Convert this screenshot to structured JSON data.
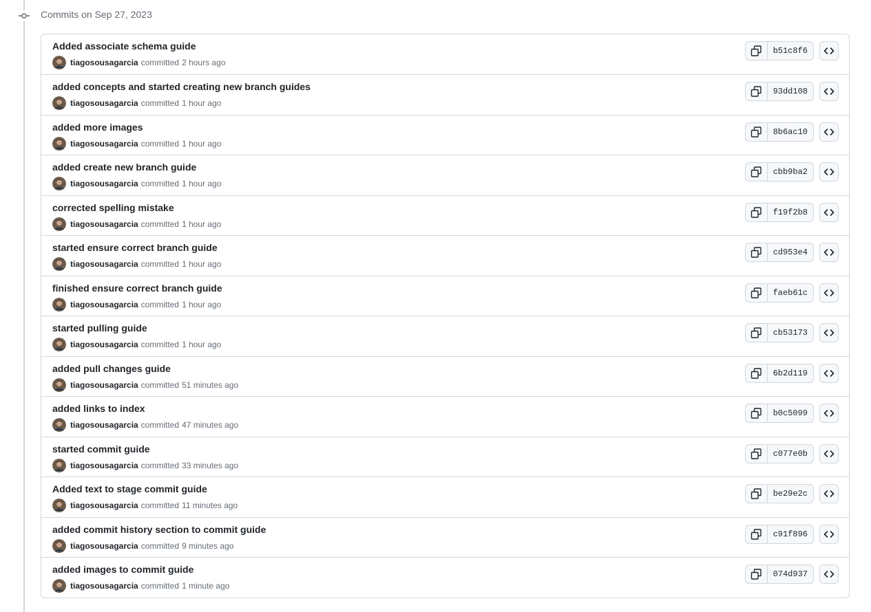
{
  "group": {
    "title": "Commits on Sep 27, 2023",
    "icon": "git-commit-icon"
  },
  "colors": {
    "border": "#d0d7de",
    "muted_text": "#656d76",
    "primary_text": "#1f2328",
    "button_bg": "#f6f8fa"
  },
  "commits": [
    {
      "message": "Added associate schema guide",
      "author": "tiagosousagarcia",
      "verb": "committed",
      "time": "2 hours ago",
      "sha": "b51c8f6"
    },
    {
      "message": "added concepts and started creating new branch guides",
      "author": "tiagosousagarcia",
      "verb": "committed",
      "time": "1 hour ago",
      "sha": "93dd108"
    },
    {
      "message": "added more images",
      "author": "tiagosousagarcia",
      "verb": "committed",
      "time": "1 hour ago",
      "sha": "8b6ac10"
    },
    {
      "message": "added create new branch guide",
      "author": "tiagosousagarcia",
      "verb": "committed",
      "time": "1 hour ago",
      "sha": "cbb9ba2"
    },
    {
      "message": "corrected spelling mistake",
      "author": "tiagosousagarcia",
      "verb": "committed",
      "time": "1 hour ago",
      "sha": "f19f2b8"
    },
    {
      "message": "started ensure correct branch guide",
      "author": "tiagosousagarcia",
      "verb": "committed",
      "time": "1 hour ago",
      "sha": "cd953e4"
    },
    {
      "message": "finished ensure correct branch guide",
      "author": "tiagosousagarcia",
      "verb": "committed",
      "time": "1 hour ago",
      "sha": "faeb61c"
    },
    {
      "message": "started pulling guide",
      "author": "tiagosousagarcia",
      "verb": "committed",
      "time": "1 hour ago",
      "sha": "cb53173"
    },
    {
      "message": "added pull changes guide",
      "author": "tiagosousagarcia",
      "verb": "committed",
      "time": "51 minutes ago",
      "sha": "6b2d119"
    },
    {
      "message": "added links to index",
      "author": "tiagosousagarcia",
      "verb": "committed",
      "time": "47 minutes ago",
      "sha": "b0c5099"
    },
    {
      "message": "started commit guide",
      "author": "tiagosousagarcia",
      "verb": "committed",
      "time": "33 minutes ago",
      "sha": "c077e0b"
    },
    {
      "message": "Added text to stage commit guide",
      "author": "tiagosousagarcia",
      "verb": "committed",
      "time": "11 minutes ago",
      "sha": "be29e2c"
    },
    {
      "message": "added commit history section to commit guide",
      "author": "tiagosousagarcia",
      "verb": "committed",
      "time": "9 minutes ago",
      "sha": "c91f896"
    },
    {
      "message": "added images to commit guide",
      "author": "tiagosousagarcia",
      "verb": "committed",
      "time": "1 minute ago",
      "sha": "074d937"
    }
  ],
  "icons": {
    "copy": "copy-icon",
    "browse": "code-icon",
    "avatar": "avatar"
  }
}
